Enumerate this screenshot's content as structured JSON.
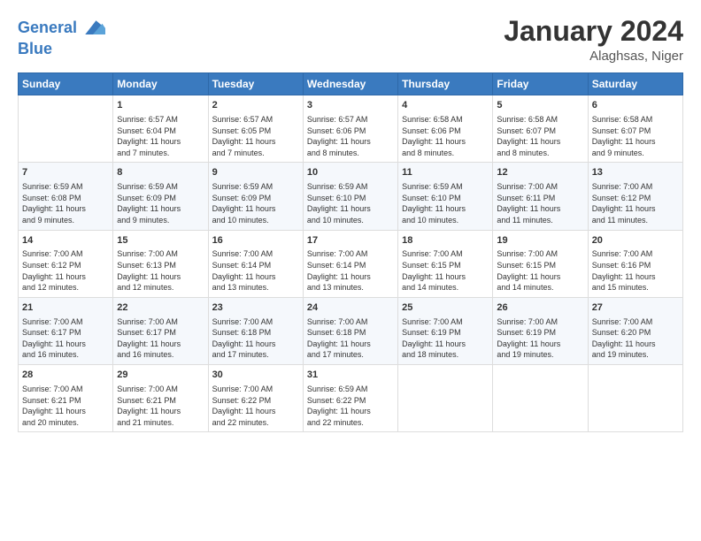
{
  "header": {
    "logo_line1": "General",
    "logo_line2": "Blue",
    "month": "January 2024",
    "location": "Alaghsas, Niger"
  },
  "days_of_week": [
    "Sunday",
    "Monday",
    "Tuesday",
    "Wednesday",
    "Thursday",
    "Friday",
    "Saturday"
  ],
  "weeks": [
    [
      {
        "num": "",
        "text": ""
      },
      {
        "num": "1",
        "text": "Sunrise: 6:57 AM\nSunset: 6:04 PM\nDaylight: 11 hours\nand 7 minutes."
      },
      {
        "num": "2",
        "text": "Sunrise: 6:57 AM\nSunset: 6:05 PM\nDaylight: 11 hours\nand 7 minutes."
      },
      {
        "num": "3",
        "text": "Sunrise: 6:57 AM\nSunset: 6:06 PM\nDaylight: 11 hours\nand 8 minutes."
      },
      {
        "num": "4",
        "text": "Sunrise: 6:58 AM\nSunset: 6:06 PM\nDaylight: 11 hours\nand 8 minutes."
      },
      {
        "num": "5",
        "text": "Sunrise: 6:58 AM\nSunset: 6:07 PM\nDaylight: 11 hours\nand 8 minutes."
      },
      {
        "num": "6",
        "text": "Sunrise: 6:58 AM\nSunset: 6:07 PM\nDaylight: 11 hours\nand 9 minutes."
      }
    ],
    [
      {
        "num": "7",
        "text": "Sunrise: 6:59 AM\nSunset: 6:08 PM\nDaylight: 11 hours\nand 9 minutes."
      },
      {
        "num": "8",
        "text": "Sunrise: 6:59 AM\nSunset: 6:09 PM\nDaylight: 11 hours\nand 9 minutes."
      },
      {
        "num": "9",
        "text": "Sunrise: 6:59 AM\nSunset: 6:09 PM\nDaylight: 11 hours\nand 10 minutes."
      },
      {
        "num": "10",
        "text": "Sunrise: 6:59 AM\nSunset: 6:10 PM\nDaylight: 11 hours\nand 10 minutes."
      },
      {
        "num": "11",
        "text": "Sunrise: 6:59 AM\nSunset: 6:10 PM\nDaylight: 11 hours\nand 10 minutes."
      },
      {
        "num": "12",
        "text": "Sunrise: 7:00 AM\nSunset: 6:11 PM\nDaylight: 11 hours\nand 11 minutes."
      },
      {
        "num": "13",
        "text": "Sunrise: 7:00 AM\nSunset: 6:12 PM\nDaylight: 11 hours\nand 11 minutes."
      }
    ],
    [
      {
        "num": "14",
        "text": "Sunrise: 7:00 AM\nSunset: 6:12 PM\nDaylight: 11 hours\nand 12 minutes."
      },
      {
        "num": "15",
        "text": "Sunrise: 7:00 AM\nSunset: 6:13 PM\nDaylight: 11 hours\nand 12 minutes."
      },
      {
        "num": "16",
        "text": "Sunrise: 7:00 AM\nSunset: 6:14 PM\nDaylight: 11 hours\nand 13 minutes."
      },
      {
        "num": "17",
        "text": "Sunrise: 7:00 AM\nSunset: 6:14 PM\nDaylight: 11 hours\nand 13 minutes."
      },
      {
        "num": "18",
        "text": "Sunrise: 7:00 AM\nSunset: 6:15 PM\nDaylight: 11 hours\nand 14 minutes."
      },
      {
        "num": "19",
        "text": "Sunrise: 7:00 AM\nSunset: 6:15 PM\nDaylight: 11 hours\nand 14 minutes."
      },
      {
        "num": "20",
        "text": "Sunrise: 7:00 AM\nSunset: 6:16 PM\nDaylight: 11 hours\nand 15 minutes."
      }
    ],
    [
      {
        "num": "21",
        "text": "Sunrise: 7:00 AM\nSunset: 6:17 PM\nDaylight: 11 hours\nand 16 minutes."
      },
      {
        "num": "22",
        "text": "Sunrise: 7:00 AM\nSunset: 6:17 PM\nDaylight: 11 hours\nand 16 minutes."
      },
      {
        "num": "23",
        "text": "Sunrise: 7:00 AM\nSunset: 6:18 PM\nDaylight: 11 hours\nand 17 minutes."
      },
      {
        "num": "24",
        "text": "Sunrise: 7:00 AM\nSunset: 6:18 PM\nDaylight: 11 hours\nand 17 minutes."
      },
      {
        "num": "25",
        "text": "Sunrise: 7:00 AM\nSunset: 6:19 PM\nDaylight: 11 hours\nand 18 minutes."
      },
      {
        "num": "26",
        "text": "Sunrise: 7:00 AM\nSunset: 6:19 PM\nDaylight: 11 hours\nand 19 minutes."
      },
      {
        "num": "27",
        "text": "Sunrise: 7:00 AM\nSunset: 6:20 PM\nDaylight: 11 hours\nand 19 minutes."
      }
    ],
    [
      {
        "num": "28",
        "text": "Sunrise: 7:00 AM\nSunset: 6:21 PM\nDaylight: 11 hours\nand 20 minutes."
      },
      {
        "num": "29",
        "text": "Sunrise: 7:00 AM\nSunset: 6:21 PM\nDaylight: 11 hours\nand 21 minutes."
      },
      {
        "num": "30",
        "text": "Sunrise: 7:00 AM\nSunset: 6:22 PM\nDaylight: 11 hours\nand 22 minutes."
      },
      {
        "num": "31",
        "text": "Sunrise: 6:59 AM\nSunset: 6:22 PM\nDaylight: 11 hours\nand 22 minutes."
      },
      {
        "num": "",
        "text": ""
      },
      {
        "num": "",
        "text": ""
      },
      {
        "num": "",
        "text": ""
      }
    ]
  ]
}
